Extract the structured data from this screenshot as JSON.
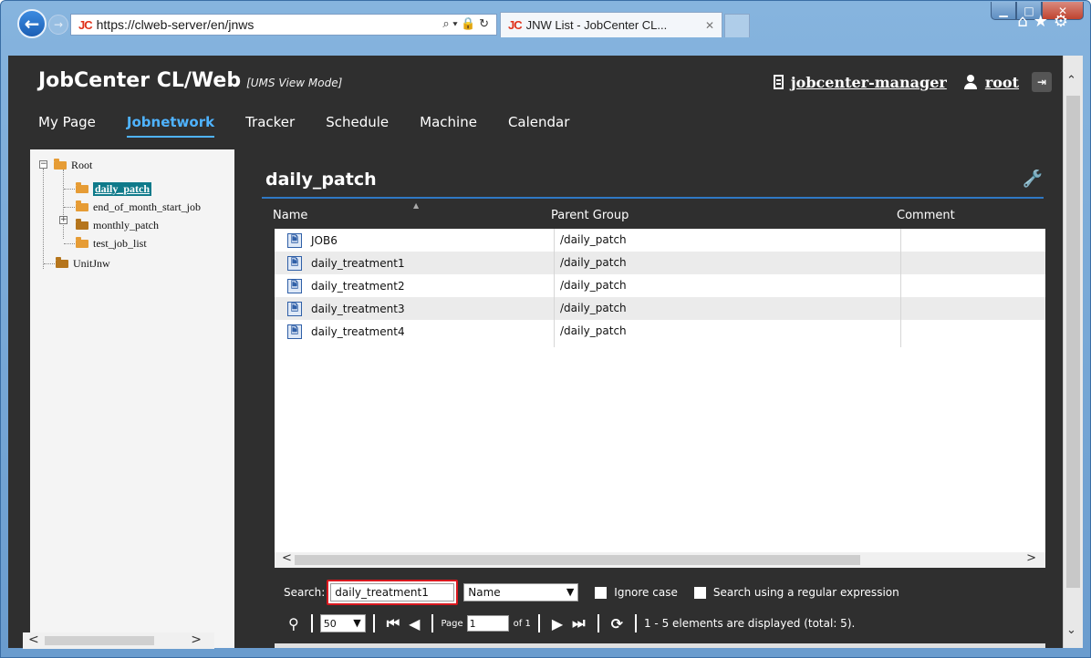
{
  "browser": {
    "url": "https://clweb-server/en/jnws",
    "tab_title": "JNW List - JobCenter CL...",
    "jc_logo": "JC"
  },
  "header": {
    "app_title": "JobCenter CL/Web",
    "mode": "[UMS View Mode]",
    "server": "jobcenter-manager",
    "user": "root"
  },
  "nav": {
    "items": [
      "My Page",
      "Jobnetwork",
      "Tracker",
      "Schedule",
      "Machine",
      "Calendar"
    ],
    "active": "Jobnetwork"
  },
  "tree": {
    "root": "Root",
    "children": [
      "daily_patch",
      "end_of_month_start_job",
      "monthly_patch",
      "test_job_list"
    ],
    "second_root": "UnitJnw"
  },
  "panel": {
    "title": "daily_patch",
    "columns": [
      "Name",
      "Parent Group",
      "Comment"
    ],
    "rows": [
      {
        "name": "JOB6",
        "parent": "/daily_patch",
        "comment": ""
      },
      {
        "name": "daily_treatment1",
        "parent": "/daily_patch",
        "comment": ""
      },
      {
        "name": "daily_treatment2",
        "parent": "/daily_patch",
        "comment": ""
      },
      {
        "name": "daily_treatment3",
        "parent": "/daily_patch",
        "comment": ""
      },
      {
        "name": "daily_treatment4",
        "parent": "/daily_patch",
        "comment": ""
      }
    ]
  },
  "search": {
    "label": "Search:",
    "value": "daily_treatment1",
    "column": "Name",
    "ignore_case": "Ignore case",
    "regex": "Search using a regular expression"
  },
  "pager": {
    "page_size": "50",
    "page_label": "Page",
    "page": "1",
    "of_label": "of 1",
    "status": "1 - 5 elements are displayed (total: 5)."
  },
  "colors": {
    "accent": "#4fb3ff",
    "header_bg": "#2f2f2f",
    "highlight_border": "#d9181e",
    "selected_node": "#0f7a8a"
  }
}
